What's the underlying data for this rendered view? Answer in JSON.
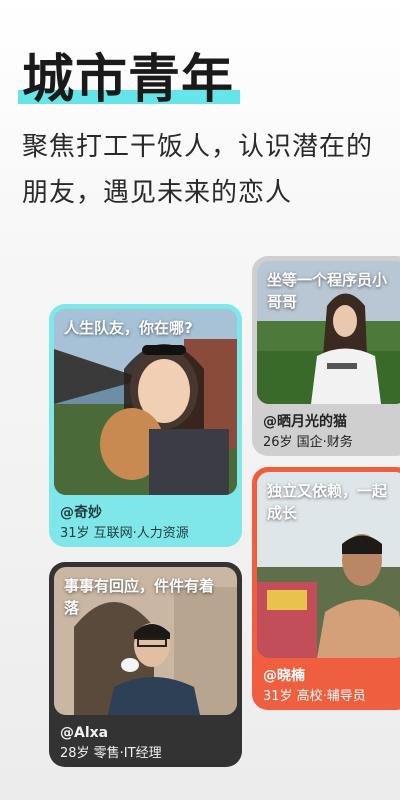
{
  "hero": {
    "title": "城市青年",
    "subtitle_line1": "聚焦打工干饭人，认识潜在的",
    "subtitle_line2": "朋友，遇见未来的恋人",
    "highlight_color": "#66e5e8"
  },
  "cards": [
    {
      "id": "qimiao",
      "caption": "人生队友，你在哪?",
      "handle": "@奇妙",
      "info": "31岁 互联网·人力资源",
      "frame_color": "#7fe7ea"
    },
    {
      "id": "shai",
      "caption": "坐等一个程序员小哥哥",
      "handle": "@晒月光的猫",
      "info": "26岁 国企·财务",
      "frame_color": "#cfcfcf"
    },
    {
      "id": "xiaonan",
      "caption": "独立又依赖，一起成长",
      "handle": "@晓楠",
      "info": "31岁 高校·辅导员",
      "frame_color": "#ef5f3f"
    },
    {
      "id": "alxa",
      "caption": "事事有回应，件件有着落",
      "handle": "@Alxa",
      "info": "28岁 零售·IT经理",
      "frame_color": "#333333"
    }
  ]
}
